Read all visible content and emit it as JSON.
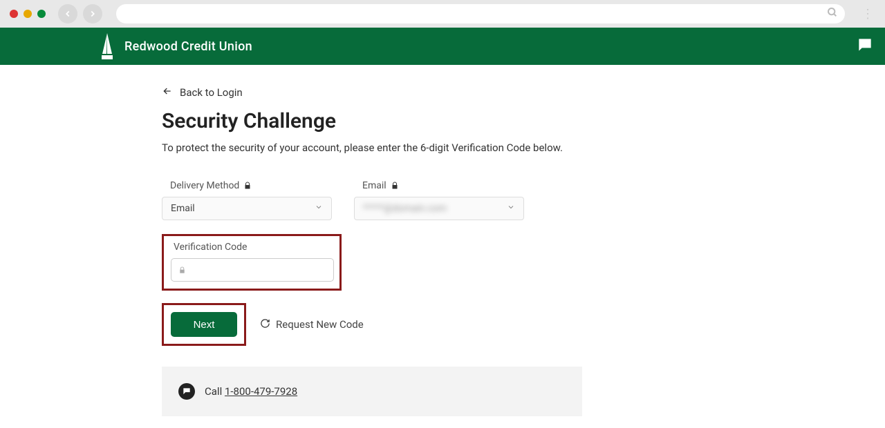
{
  "brand": {
    "name": "Redwood Credit Union"
  },
  "nav": {
    "back_label": "Back to Login"
  },
  "page": {
    "title": "Security Challenge",
    "subtitle": "To protect the security of your account, please enter the 6-digit Verification Code below."
  },
  "fields": {
    "delivery_method": {
      "label": "Delivery Method",
      "value": "Email"
    },
    "email": {
      "label": "Email",
      "value": "*****@domain.com"
    },
    "verification_code": {
      "label": "Verification Code",
      "value": ""
    }
  },
  "actions": {
    "next": "Next",
    "request_new_code": "Request New Code"
  },
  "help": {
    "call_prefix": "Call ",
    "phone": "1-800-479-7928"
  }
}
